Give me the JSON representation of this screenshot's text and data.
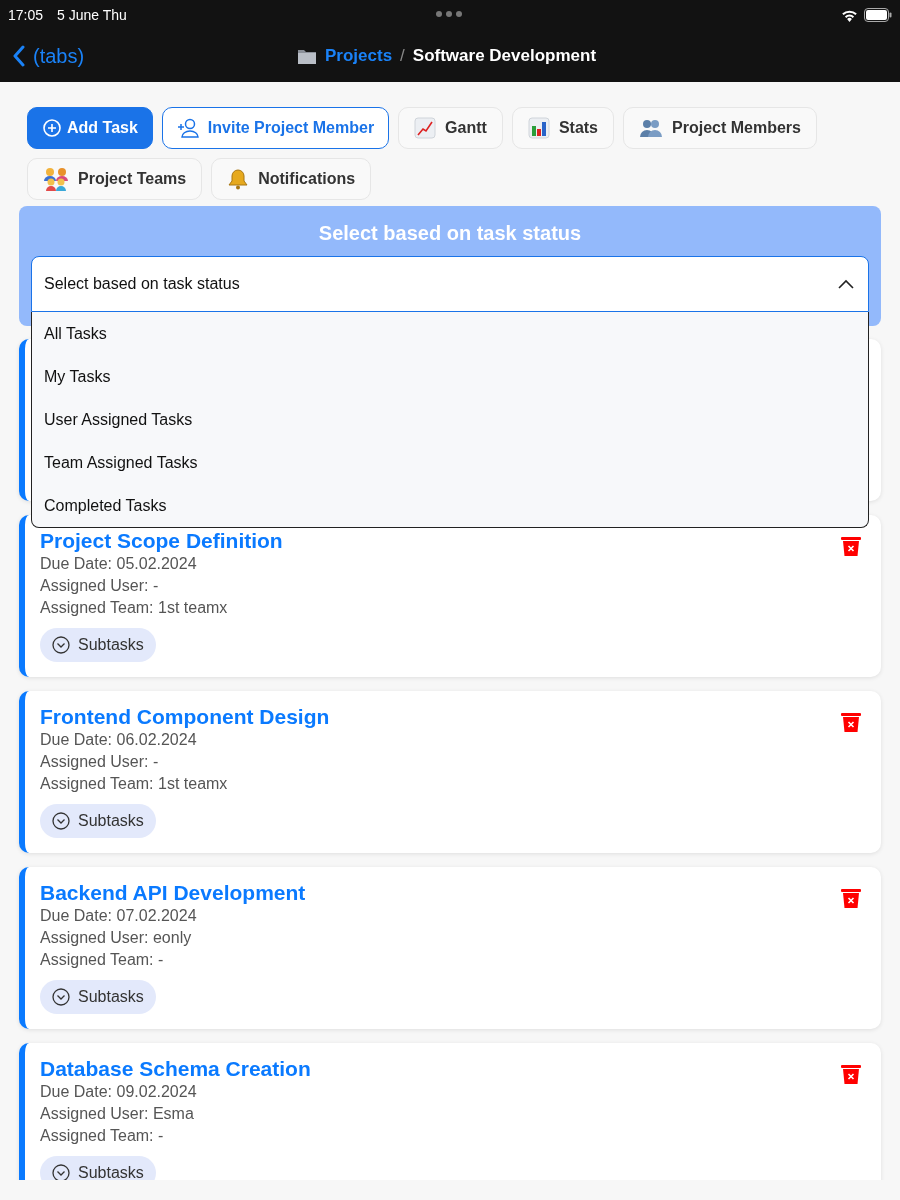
{
  "status_bar": {
    "time": "17:05",
    "date": "5 June Thu"
  },
  "nav": {
    "back": "(tabs)",
    "breadcrumb": "Projects",
    "separator": "/",
    "title": "Software Development"
  },
  "toolbar": [
    {
      "label": "Add Task",
      "kind": "primary"
    },
    {
      "label": "Invite Project Member",
      "kind": "outline"
    },
    {
      "label": "Gantt",
      "kind": "plain"
    },
    {
      "label": "Stats",
      "kind": "plain"
    },
    {
      "label": "Project Members",
      "kind": "plain"
    },
    {
      "label": "Project Teams",
      "kind": "plain"
    },
    {
      "label": "Notifications",
      "kind": "plain"
    }
  ],
  "filter": {
    "title": "Select based on task status",
    "value": "Select based on task status",
    "expanded": true,
    "options": [
      {
        "label": "All Tasks",
        "selected": false
      },
      {
        "label": "My Tasks",
        "selected": false
      },
      {
        "label": "User Assigned Tasks",
        "selected": false
      },
      {
        "label": "Team Assigned Tasks",
        "selected": false
      },
      {
        "label": "Completed Tasks",
        "selected": false
      }
    ]
  },
  "tasks": [
    {
      "title": "Project Scope Definition",
      "lines": [
        "Due Date: 05.02.2024",
        "Assigned User: -",
        "Assigned Team: 1st teamx"
      ],
      "subtasks": "Subtasks"
    },
    {
      "title": "Frontend Component Design",
      "lines": [
        "Due Date: 06.02.2024",
        "Assigned User: -",
        "Assigned Team: 1st teamx"
      ],
      "subtasks": "Subtasks"
    },
    {
      "title": "Backend API Development",
      "lines": [
        "Due Date: 07.02.2024",
        "Assigned User: eonly",
        "Assigned Team: -"
      ],
      "subtasks": "Subtasks"
    },
    {
      "title": "Database Schema Creation",
      "lines": [
        "Due Date: 09.02.2024",
        "Assigned User: Esma",
        "Assigned Team: -"
      ],
      "subtasks": "Subtasks"
    }
  ]
}
